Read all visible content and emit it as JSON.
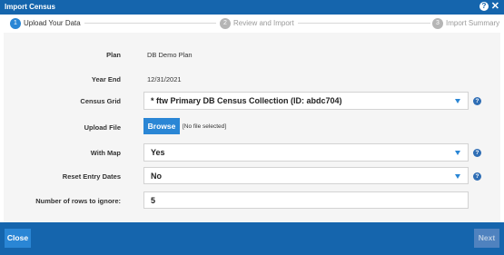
{
  "dialog": {
    "title": "Import Census",
    "help_icon": "question-circle-icon",
    "close_icon": "close-x-icon"
  },
  "steps": [
    {
      "num": "1",
      "label": "Upload Your Data",
      "active": true
    },
    {
      "num": "2",
      "label": "Review and Import",
      "active": false
    },
    {
      "num": "3",
      "label": "Import Summary",
      "active": false
    }
  ],
  "form": {
    "plan_label": "Plan",
    "plan_value": "DB Demo Plan",
    "year_end_label": "Year End",
    "year_end_value": "12/31/2021",
    "census_grid_label": "Census Grid",
    "census_grid_value": "* ftw Primary DB Census Collection  (ID: abdc704)",
    "upload_file_label": "Upload File",
    "browse_label": "Browse",
    "no_file_text": "[No file selected]",
    "with_map_label": "With Map",
    "with_map_value": "Yes",
    "reset_entry_dates_label": "Reset Entry Dates",
    "reset_entry_dates_value": "No",
    "rows_to_ignore_label": "Number of rows to ignore:",
    "rows_to_ignore_value": "5"
  },
  "footer": {
    "close_label": "Close",
    "next_label": "Next"
  },
  "colors": {
    "header_blue": "#1565ad",
    "accent_blue": "#2a86d5",
    "disabled_blue": "#4f82bf"
  }
}
